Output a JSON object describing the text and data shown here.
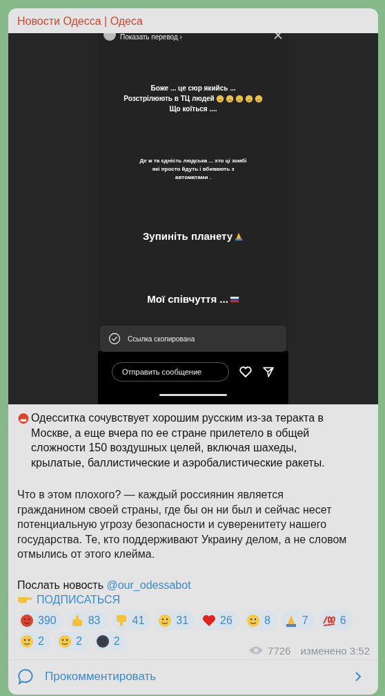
{
  "channel": {
    "title": "Новости Одесса | Одеса"
  },
  "story": {
    "translate_link": "Показать перевод ›",
    "blocks": [
      {
        "kind": "small",
        "lines": [
          {
            "text": "Боже ... це сюр якийсь ..."
          },
          {
            "text": "Розстрілюють в ТЦ людей"
          },
          {
            "text": "Що коїться ...."
          }
        ]
      },
      {
        "kind": "tiny",
        "lines": [
          {
            "text": "Де ж та єдність людська ... хто ці зомбі"
          },
          {
            "text": "які просто йдуть і вбивають з"
          },
          {
            "text": "автоматами ."
          }
        ]
      },
      {
        "kind": "big",
        "lines": [
          {
            "text": "Зупиніть планету"
          }
        ]
      },
      {
        "kind": "big",
        "lines": [
          {
            "text": "Мої співчуття ..."
          }
        ]
      }
    ],
    "toast": "Ссылка скопирована",
    "message_placeholder": "Отправить сообщение"
  },
  "post": {
    "paragraphs": [
      "Одесситка сочувствует хорошим русским из-за теракта в Москве, а еще вчера по ее стране прилетело в общей сложности 150 воздушных целей, включая шахеды, крылатые, баллистические и аэробалистические ракеты.",
      "Что в этом плохого? — каждый россиянин является гражданином своей страны, где бы он ни был и сейчас несет потенциальную угрозу безопасности и суверенитету нашего государства. Те, кто поддерживают Украину делом, а не словом отмылись от этого клейма."
    ],
    "send_news": "Послать новость",
    "bot_link": "@our_odessabot",
    "subscribe": "ПОДПИСАТЬСЯ"
  },
  "reactions": [
    {
      "kind": "angry",
      "count": "390"
    },
    {
      "kind": "thumbs-up",
      "count": "83"
    },
    {
      "kind": "thumbs-down",
      "count": "41"
    },
    {
      "kind": "woozy",
      "count": "31"
    },
    {
      "kind": "heart",
      "count": "26"
    },
    {
      "kind": "laugh",
      "count": "8"
    },
    {
      "kind": "pray",
      "count": "7"
    },
    {
      "kind": "hundred",
      "count": "6"
    },
    {
      "kind": "grin",
      "count": "2"
    },
    {
      "kind": "scream",
      "count": "2"
    },
    {
      "kind": "moon",
      "count": "2"
    }
  ],
  "views": "7726",
  "edited": "изменено 3:52",
  "comment": "Прокомментировать"
}
